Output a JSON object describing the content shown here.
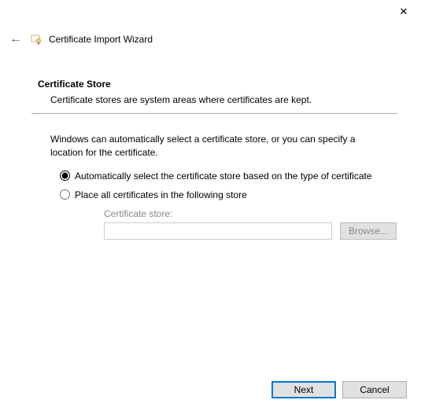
{
  "titlebar": {
    "close_glyph": "✕"
  },
  "header": {
    "back_glyph": "←",
    "title": "Certificate Import Wizard"
  },
  "section": {
    "title": "Certificate Store",
    "subtitle": "Certificate stores are system areas where certificates are kept."
  },
  "instructions": "Windows can automatically select a certificate store, or you can specify a location for the certificate.",
  "radios": {
    "auto": {
      "label": "Automatically select the certificate store based on the type of certificate",
      "checked": true
    },
    "manual": {
      "label": "Place all certificates in the following store",
      "checked": false
    }
  },
  "store": {
    "label": "Certificate store:",
    "value": "",
    "browse_label": "Browse...",
    "enabled": false
  },
  "footer": {
    "next_label": "Next",
    "cancel_label": "Cancel"
  }
}
